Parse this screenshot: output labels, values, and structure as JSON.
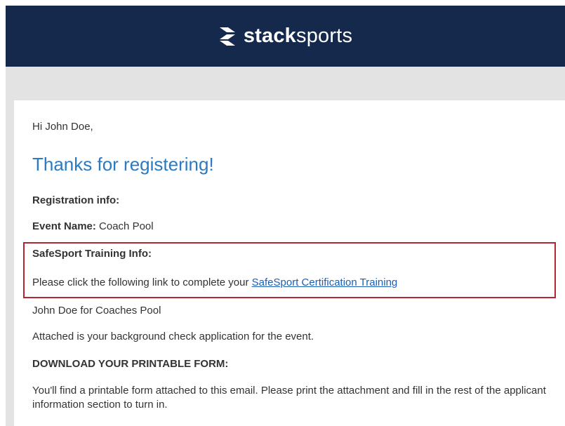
{
  "brand": {
    "logo_bold": "stack",
    "logo_light": "sports",
    "header_color": "#14294b"
  },
  "email": {
    "greeting": "Hi John Doe,",
    "title": "Thanks for registering!",
    "registration_info_label": "Registration info:",
    "event_name_label": "Event Name:",
    "event_name_value": " Coach Pool",
    "safesport_title": "SafeSport Training Info:",
    "safesport_text": "Please click the following link to complete your ",
    "safesport_link": "SafeSport Certification Training",
    "participant_line": "John Doe for Coaches Pool",
    "attached_line": "Attached is your background check application for the event.",
    "download_heading": "DOWNLOAD YOUR PRINTABLE FORM:",
    "printable_note": "You'll find a printable form attached to this email. Please print the attachment and fill in the rest of the applicant information section to turn in."
  },
  "colors": {
    "title_blue": "#2d7ac0",
    "highlight_border": "#b3262f",
    "link_blue": "#1a5fb4"
  }
}
